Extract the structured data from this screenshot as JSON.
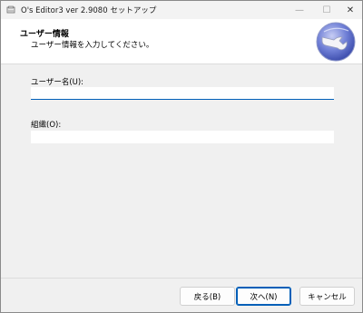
{
  "window": {
    "title": "O's Editor3 ver 2.9080 セットアップ",
    "minimize_glyph": "—",
    "maximize_glyph": "☐",
    "close_glyph": "✕"
  },
  "header": {
    "title": "ユーザー情報",
    "subtitle": "ユーザー情報を入力してください。"
  },
  "form": {
    "user_name": {
      "label": "ユーザー名(U):",
      "value": ""
    },
    "organization": {
      "label": "組織(O):",
      "value": ""
    }
  },
  "buttons": {
    "back": "戻る(B)",
    "next": "次へ(N)",
    "cancel": "キャンセル"
  },
  "colors": {
    "accent": "#005fb8",
    "background": "#f0f0f0",
    "header_bg": "#ffffff"
  },
  "icons": {
    "app": "setup-app-icon",
    "logo": "globe-wrench-logo"
  }
}
